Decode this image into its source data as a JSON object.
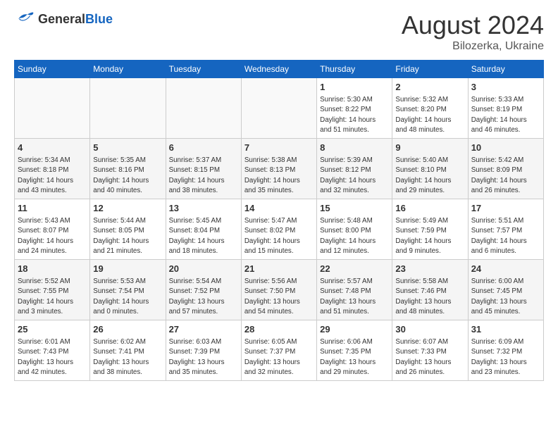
{
  "header": {
    "logo_general": "General",
    "logo_blue": "Blue",
    "month_year": "August 2024",
    "location": "Bilozerka, Ukraine"
  },
  "weekdays": [
    "Sunday",
    "Monday",
    "Tuesday",
    "Wednesday",
    "Thursday",
    "Friday",
    "Saturday"
  ],
  "weeks": [
    [
      {
        "day": "",
        "info": ""
      },
      {
        "day": "",
        "info": ""
      },
      {
        "day": "",
        "info": ""
      },
      {
        "day": "",
        "info": ""
      },
      {
        "day": "1",
        "info": "Sunrise: 5:30 AM\nSunset: 8:22 PM\nDaylight: 14 hours\nand 51 minutes."
      },
      {
        "day": "2",
        "info": "Sunrise: 5:32 AM\nSunset: 8:20 PM\nDaylight: 14 hours\nand 48 minutes."
      },
      {
        "day": "3",
        "info": "Sunrise: 5:33 AM\nSunset: 8:19 PM\nDaylight: 14 hours\nand 46 minutes."
      }
    ],
    [
      {
        "day": "4",
        "info": "Sunrise: 5:34 AM\nSunset: 8:18 PM\nDaylight: 14 hours\nand 43 minutes."
      },
      {
        "day": "5",
        "info": "Sunrise: 5:35 AM\nSunset: 8:16 PM\nDaylight: 14 hours\nand 40 minutes."
      },
      {
        "day": "6",
        "info": "Sunrise: 5:37 AM\nSunset: 8:15 PM\nDaylight: 14 hours\nand 38 minutes."
      },
      {
        "day": "7",
        "info": "Sunrise: 5:38 AM\nSunset: 8:13 PM\nDaylight: 14 hours\nand 35 minutes."
      },
      {
        "day": "8",
        "info": "Sunrise: 5:39 AM\nSunset: 8:12 PM\nDaylight: 14 hours\nand 32 minutes."
      },
      {
        "day": "9",
        "info": "Sunrise: 5:40 AM\nSunset: 8:10 PM\nDaylight: 14 hours\nand 29 minutes."
      },
      {
        "day": "10",
        "info": "Sunrise: 5:42 AM\nSunset: 8:09 PM\nDaylight: 14 hours\nand 26 minutes."
      }
    ],
    [
      {
        "day": "11",
        "info": "Sunrise: 5:43 AM\nSunset: 8:07 PM\nDaylight: 14 hours\nand 24 minutes."
      },
      {
        "day": "12",
        "info": "Sunrise: 5:44 AM\nSunset: 8:05 PM\nDaylight: 14 hours\nand 21 minutes."
      },
      {
        "day": "13",
        "info": "Sunrise: 5:45 AM\nSunset: 8:04 PM\nDaylight: 14 hours\nand 18 minutes."
      },
      {
        "day": "14",
        "info": "Sunrise: 5:47 AM\nSunset: 8:02 PM\nDaylight: 14 hours\nand 15 minutes."
      },
      {
        "day": "15",
        "info": "Sunrise: 5:48 AM\nSunset: 8:00 PM\nDaylight: 14 hours\nand 12 minutes."
      },
      {
        "day": "16",
        "info": "Sunrise: 5:49 AM\nSunset: 7:59 PM\nDaylight: 14 hours\nand 9 minutes."
      },
      {
        "day": "17",
        "info": "Sunrise: 5:51 AM\nSunset: 7:57 PM\nDaylight: 14 hours\nand 6 minutes."
      }
    ],
    [
      {
        "day": "18",
        "info": "Sunrise: 5:52 AM\nSunset: 7:55 PM\nDaylight: 14 hours\nand 3 minutes."
      },
      {
        "day": "19",
        "info": "Sunrise: 5:53 AM\nSunset: 7:54 PM\nDaylight: 14 hours\nand 0 minutes."
      },
      {
        "day": "20",
        "info": "Sunrise: 5:54 AM\nSunset: 7:52 PM\nDaylight: 13 hours\nand 57 minutes."
      },
      {
        "day": "21",
        "info": "Sunrise: 5:56 AM\nSunset: 7:50 PM\nDaylight: 13 hours\nand 54 minutes."
      },
      {
        "day": "22",
        "info": "Sunrise: 5:57 AM\nSunset: 7:48 PM\nDaylight: 13 hours\nand 51 minutes."
      },
      {
        "day": "23",
        "info": "Sunrise: 5:58 AM\nSunset: 7:46 PM\nDaylight: 13 hours\nand 48 minutes."
      },
      {
        "day": "24",
        "info": "Sunrise: 6:00 AM\nSunset: 7:45 PM\nDaylight: 13 hours\nand 45 minutes."
      }
    ],
    [
      {
        "day": "25",
        "info": "Sunrise: 6:01 AM\nSunset: 7:43 PM\nDaylight: 13 hours\nand 42 minutes."
      },
      {
        "day": "26",
        "info": "Sunrise: 6:02 AM\nSunset: 7:41 PM\nDaylight: 13 hours\nand 38 minutes."
      },
      {
        "day": "27",
        "info": "Sunrise: 6:03 AM\nSunset: 7:39 PM\nDaylight: 13 hours\nand 35 minutes."
      },
      {
        "day": "28",
        "info": "Sunrise: 6:05 AM\nSunset: 7:37 PM\nDaylight: 13 hours\nand 32 minutes."
      },
      {
        "day": "29",
        "info": "Sunrise: 6:06 AM\nSunset: 7:35 PM\nDaylight: 13 hours\nand 29 minutes."
      },
      {
        "day": "30",
        "info": "Sunrise: 6:07 AM\nSunset: 7:33 PM\nDaylight: 13 hours\nand 26 minutes."
      },
      {
        "day": "31",
        "info": "Sunrise: 6:09 AM\nSunset: 7:32 PM\nDaylight: 13 hours\nand 23 minutes."
      }
    ]
  ]
}
